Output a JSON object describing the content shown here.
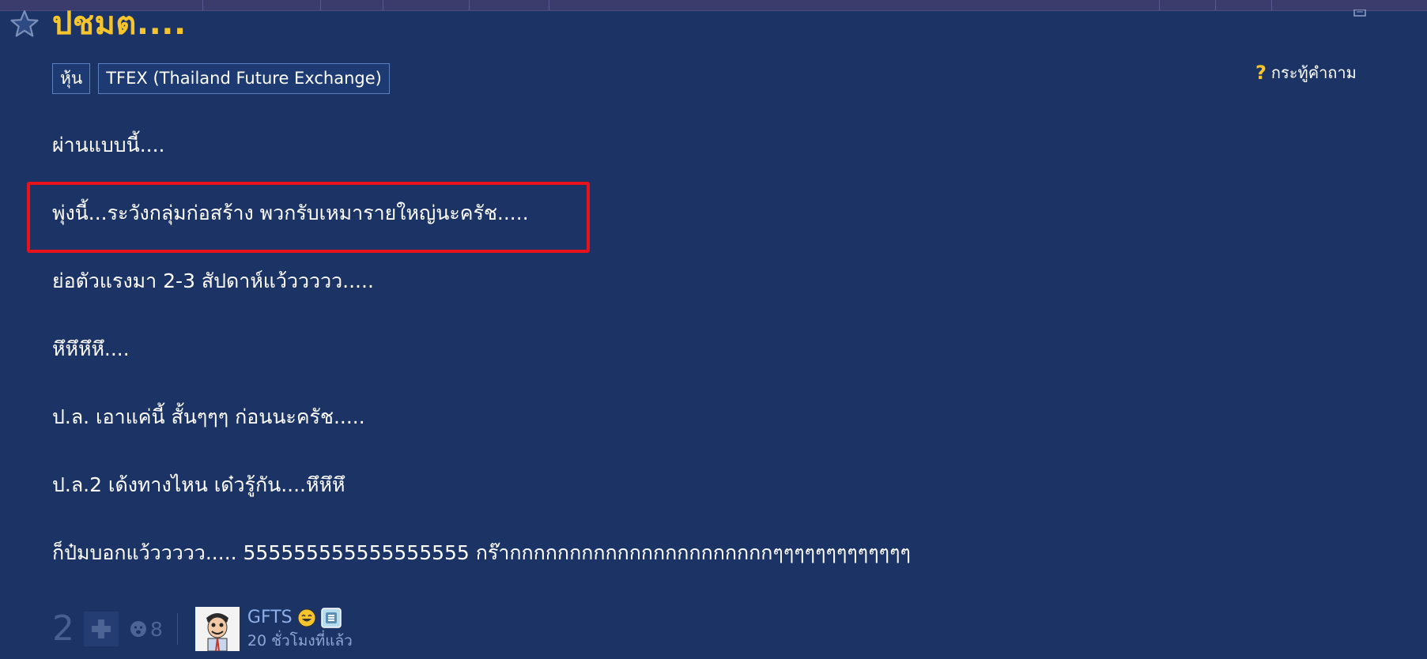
{
  "topic": {
    "title": "ปชมต....",
    "tags": [
      "หุ้น",
      "TFEX (Thailand Future Exchange)"
    ],
    "report_label": "กระทู้คำถาม"
  },
  "body": {
    "lines": [
      "ผ่านแบบนี้....",
      "พุ่งนี้...ระวังกลุ่มก่อสร้าง พวกรับเหมารายใหญ่นะครัช.....",
      "ย่อตัวแรงมา 2-3 สัปดาห์แว้ววววว.....",
      "หึหึหึหึ....",
      "ป.ล. เอาแค่นี้ สั้นๆๆๆ ก่อนนะครัช.....",
      "ป.ล.2 เด้งทางไหน เด๋วรู้กัน....หึหึหึ",
      "ก็ป๋มบอกแว้ววววว..... 555555555555555555 กร๊ากกกกกกกกกกกกกกกกกกกกกกๆๆๆๆๆๆๆๆๆๆๆๆๆ"
    ]
  },
  "footer": {
    "vote_count": "2",
    "emotion_count": "8",
    "author_name": "GFTS",
    "timestamp": "20 ชั่วโมงที่แล้ว"
  },
  "colors": {
    "background": "#1c3366",
    "title": "#f6c52d",
    "highlight": "#e8121a",
    "author": "#8fb0e8"
  },
  "icons": [
    "star-icon",
    "plus-icon",
    "emotion-icon",
    "question-icon",
    "smile-badge-icon",
    "member-badge-icon"
  ]
}
